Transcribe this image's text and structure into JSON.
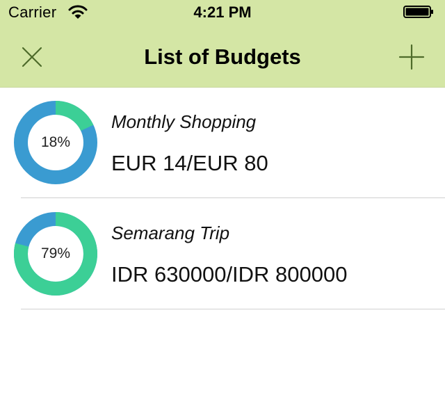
{
  "status_bar": {
    "carrier": "Carrier",
    "time": "4:21 PM",
    "wifi_icon": "wifi-icon",
    "battery_icon": "battery-icon"
  },
  "nav": {
    "title": "List of Budgets",
    "close_icon": "close-icon",
    "add_icon": "plus-icon",
    "background_color": "#d4e6a5",
    "icon_color": "#4e6b2a"
  },
  "budgets": [
    {
      "name": "Monthly Shopping",
      "amount": "EUR 14/EUR 80",
      "percent_label": "18%",
      "progress": 0.18,
      "used_color": "#3ccf96",
      "remaining_color": "#3a9bd1"
    },
    {
      "name": "Semarang Trip",
      "amount": "IDR 630000/IDR 800000",
      "percent_label": "79%",
      "progress": 0.79,
      "used_color": "#3ccf96",
      "remaining_color": "#3a9bd1"
    }
  ]
}
